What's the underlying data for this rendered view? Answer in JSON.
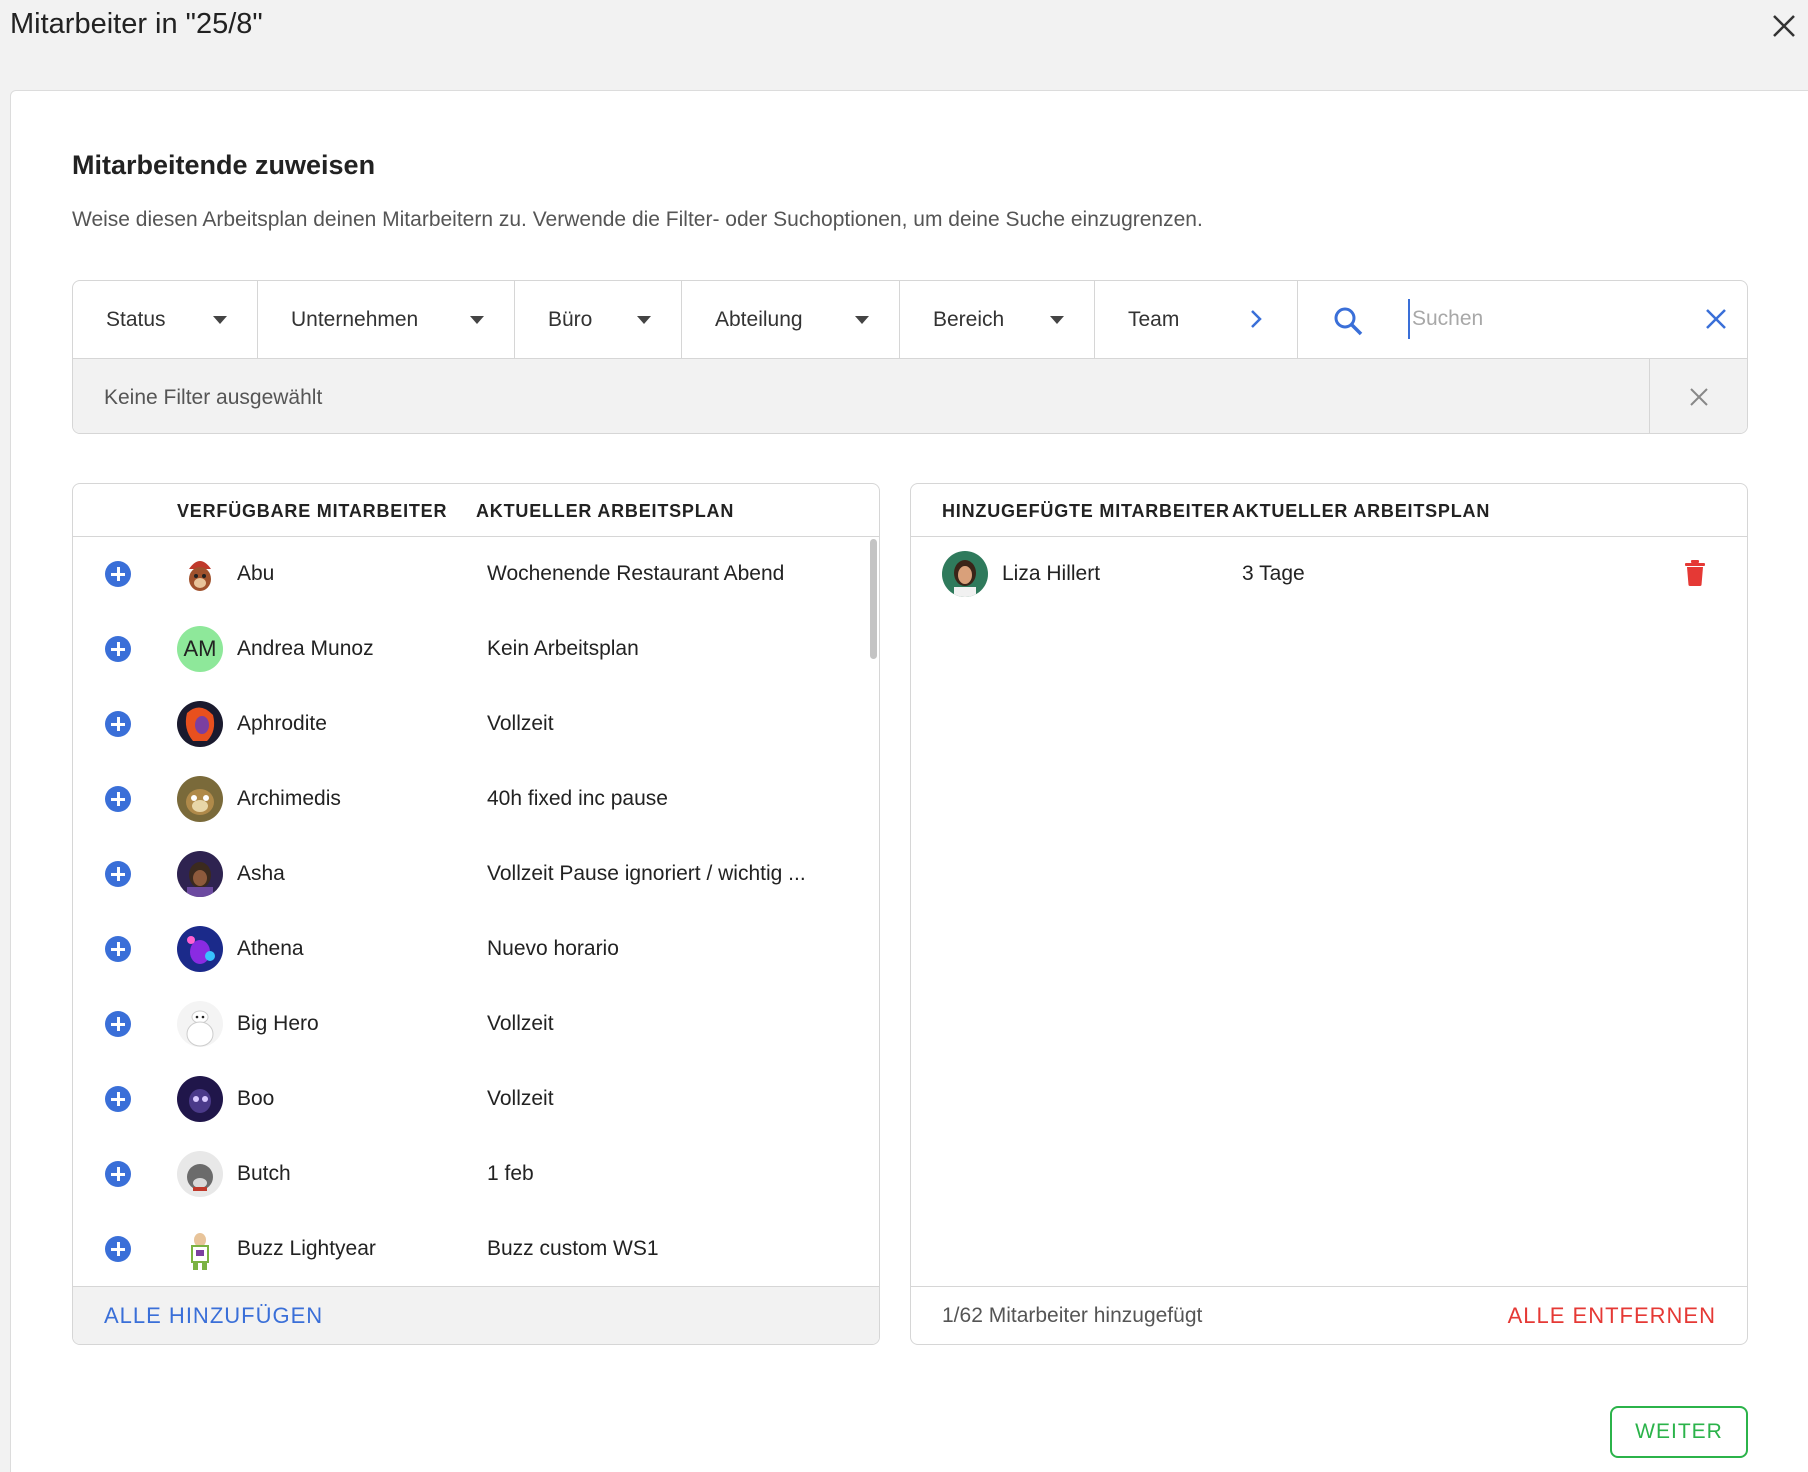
{
  "window": {
    "title": "Mitarbeiter in \"25/8\""
  },
  "header": {
    "title": "Mitarbeitende zuweisen",
    "description": "Weise diesen Arbeitsplan deinen Mitarbeitern zu. Verwende die Filter- oder Suchoptionen, um deine Suche einzugrenzen."
  },
  "filters": {
    "items": [
      {
        "label": "Status"
      },
      {
        "label": "Unternehmen"
      },
      {
        "label": "Büro"
      },
      {
        "label": "Abteilung"
      },
      {
        "label": "Bereich"
      },
      {
        "label": "Team"
      }
    ],
    "search_placeholder": "Suchen",
    "selected_text": "Keine Filter ausgewählt"
  },
  "available": {
    "col_employees": "VERFÜGBARE MITARBEITER",
    "col_schedule": "AKTUELLER ARBEITSPLAN",
    "rows": [
      {
        "name": "Abu",
        "plan": "Wochenende Restaurant Abend"
      },
      {
        "name": "Andrea Munoz",
        "plan": "Kein Arbeitsplan",
        "initials": "AM"
      },
      {
        "name": "Aphrodite",
        "plan": "Vollzeit"
      },
      {
        "name": "Archimedis",
        "plan": "40h fixed inc pause"
      },
      {
        "name": "Asha",
        "plan": "Vollzeit Pause ignoriert / wichtig ..."
      },
      {
        "name": "Athena",
        "plan": "Nuevo horario"
      },
      {
        "name": "Big Hero",
        "plan": "Vollzeit"
      },
      {
        "name": "Boo",
        "plan": "Vollzeit"
      },
      {
        "name": "Butch",
        "plan": "1 feb"
      },
      {
        "name": "Buzz Lightyear",
        "plan": "Buzz custom WS1"
      }
    ],
    "add_all": "ALLE HINZUFÜGEN"
  },
  "added": {
    "col_employees": "HINZUGEFÜGTE MITARBEITER",
    "col_schedule": "AKTUELLER ARBEITSPLAN",
    "rows": [
      {
        "name": "Liza Hillert",
        "plan": "3 Tage"
      }
    ],
    "count_text": "1/62 Mitarbeiter hinzugefügt",
    "remove_all": "ALLE ENTFERNEN"
  },
  "footer": {
    "next": "WEITER"
  },
  "colors": {
    "accent_blue": "#3a6fd8",
    "danger_red": "#e53935",
    "success_green": "#2bb34a"
  }
}
